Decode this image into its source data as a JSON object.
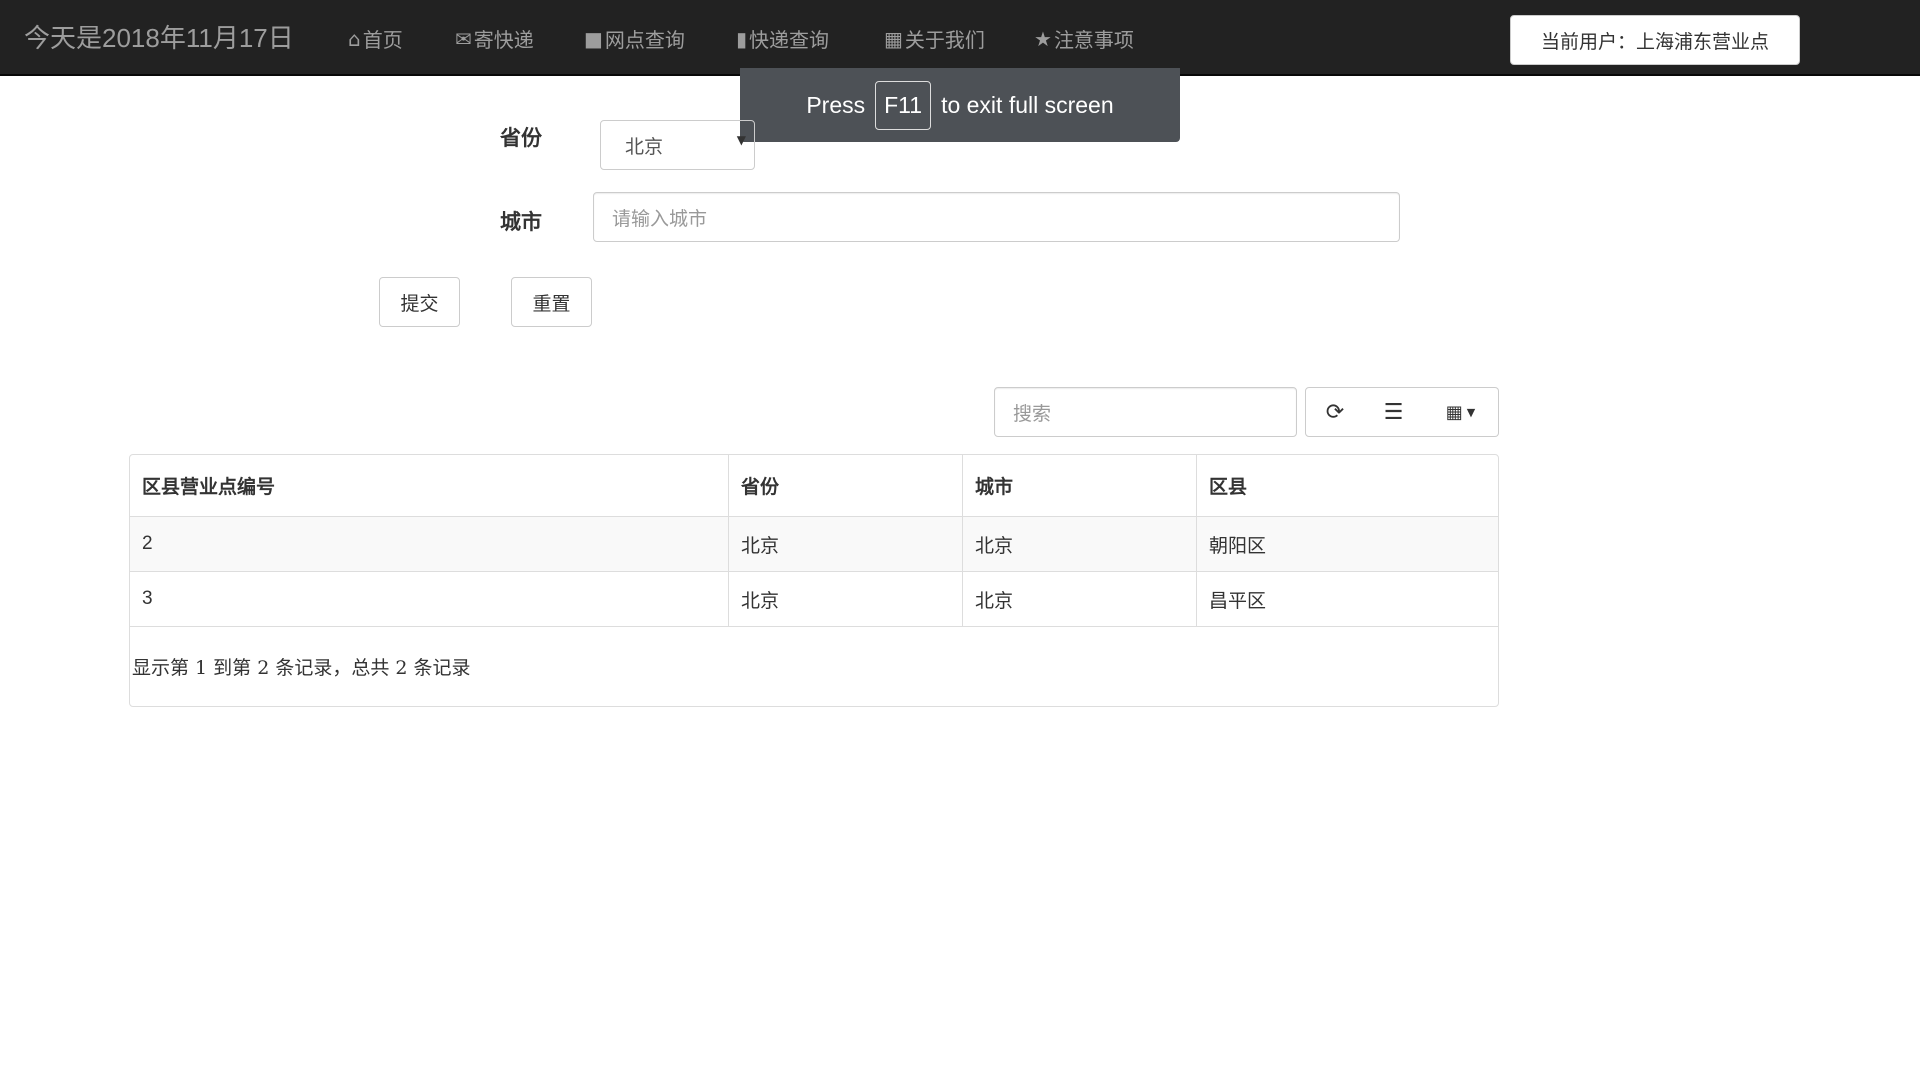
{
  "nav": {
    "brand": "今天是2018年11月17日",
    "items": [
      {
        "label": "首页",
        "icon": "home-icon"
      },
      {
        "label": "寄快递",
        "icon": "envelope-icon"
      },
      {
        "label": "网点查询",
        "icon": "lock-icon"
      },
      {
        "label": "快递查询",
        "icon": "book-icon"
      },
      {
        "label": "关于我们",
        "icon": "th-icon"
      },
      {
        "label": "注意事项",
        "icon": "star-icon"
      }
    ],
    "user": "当前用户：上海浦东营业点"
  },
  "toast": {
    "press": "Press",
    "key": "F11",
    "rest": "to exit full screen"
  },
  "form": {
    "province_label": "省份",
    "province_value": "北京",
    "city_label": "城市",
    "city_placeholder": "请输入城市",
    "submit": "提交",
    "reset": "重置"
  },
  "table": {
    "search_placeholder": "搜索",
    "headers": [
      "区县营业点编号",
      "省份",
      "城市",
      "区县"
    ],
    "rows": [
      [
        "2",
        "北京",
        "北京",
        "朝阳区"
      ],
      [
        "3",
        "北京",
        "北京",
        "昌平区"
      ]
    ],
    "footer": "显示第 1 到第 2 条记录，总共 2 条记录"
  }
}
